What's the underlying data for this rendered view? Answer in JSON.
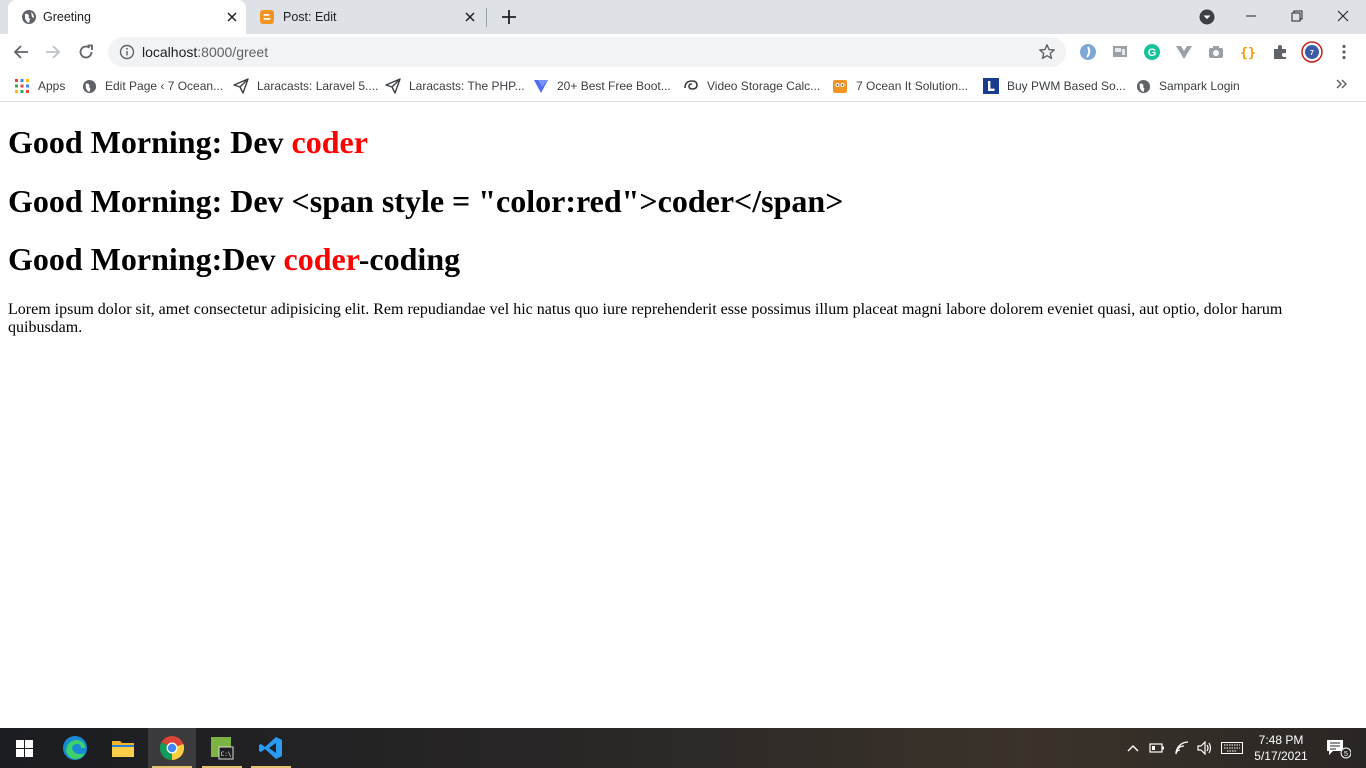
{
  "browser": {
    "tabs": [
      {
        "title": "Greeting",
        "active": true
      },
      {
        "title": "Post: Edit",
        "active": false
      }
    ],
    "omnibox": {
      "host": "localhost",
      "rest": ":8000/greet"
    },
    "bookmarks": [
      {
        "label": "Apps",
        "icon": "apps-grid-icon"
      },
      {
        "label": "Edit Page ‹ 7 Ocean...",
        "icon": "globe-icon"
      },
      {
        "label": "Laracasts: Laravel 5....",
        "icon": "send-icon"
      },
      {
        "label": "Laracasts: The PHP...",
        "icon": "send-icon"
      },
      {
        "label": "20+ Best Free Boot...",
        "icon": "bookmark-arrow-icon"
      },
      {
        "label": "Video Storage Calc...",
        "icon": "swirl-icon"
      },
      {
        "label": "7 Ocean It Solution...",
        "icon": "owl-icon"
      },
      {
        "label": "Buy PWM Based So...",
        "icon": "letter-l-icon"
      },
      {
        "label": "Sampark Login",
        "icon": "globe-icon"
      }
    ]
  },
  "page": {
    "heading1": {
      "prefix": "Good Morning: Dev ",
      "highlight": "coder"
    },
    "heading2": {
      "text": "Good Morning: Dev <span style = \"color:red\">coder</span>"
    },
    "heading3": {
      "prefix": "Good Morning:Dev ",
      "highlight": "coder",
      "suffix": "-coding"
    },
    "paragraph": "Lorem ipsum dolor sit, amet consectetur adipisicing elit. Rem repudiandae vel hic natus quo iure reprehenderit esse possimus illum placeat magni labore dolorem eveniet quasi, aut optio, dolor harum quibusdam."
  },
  "colors": {
    "highlight": "#ff0000",
    "tabstrip": "#dee1e6"
  },
  "taskbar": {
    "time": "7:48 PM",
    "date": "5/17/2021",
    "notification_count": "5"
  }
}
